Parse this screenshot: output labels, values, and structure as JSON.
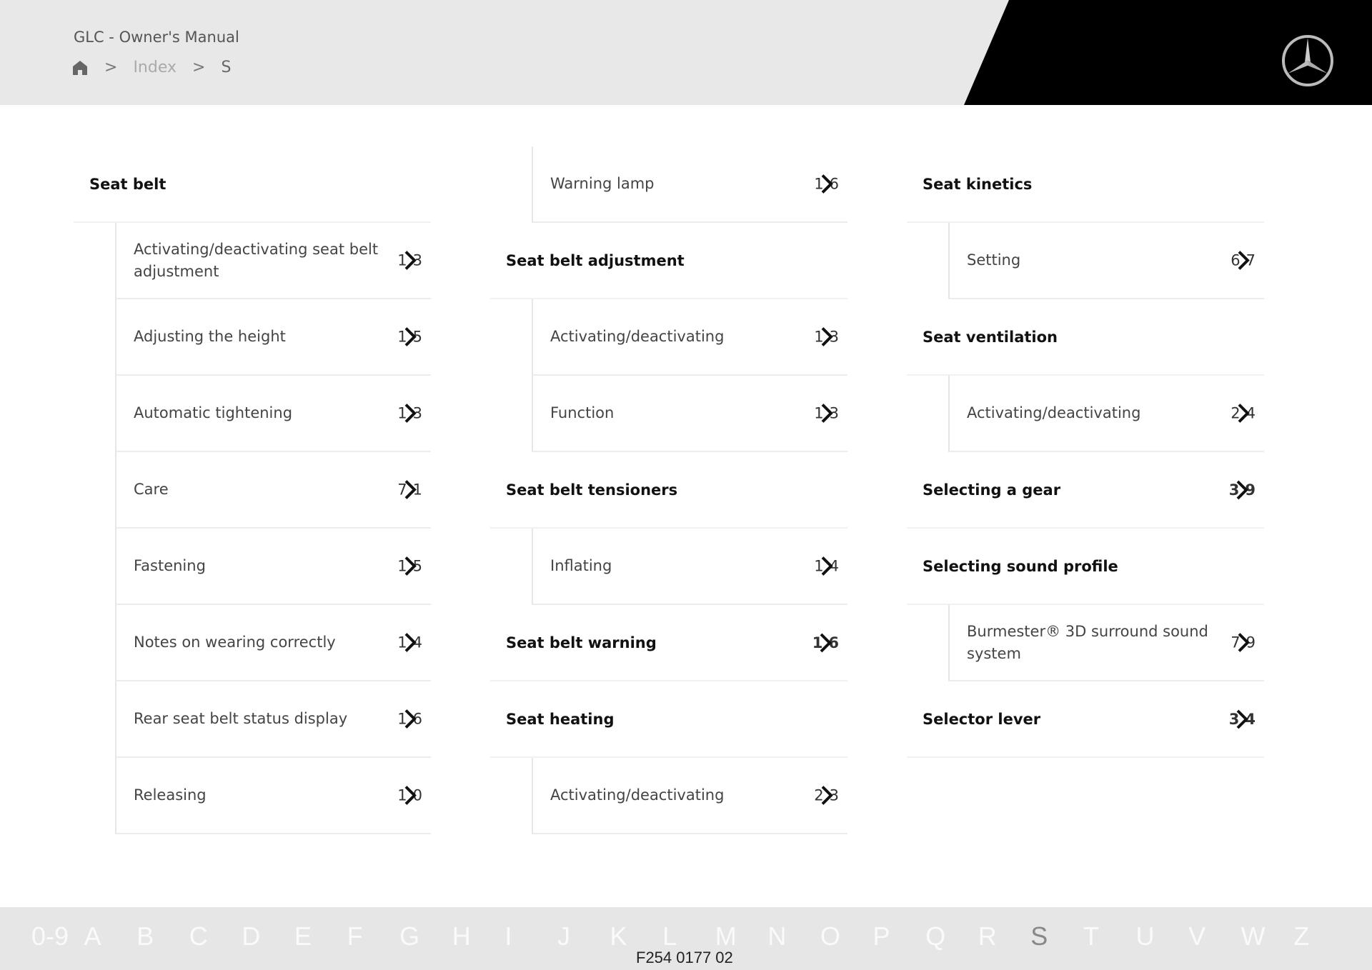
{
  "header": {
    "title": "GLC - Owner's Manual",
    "breadcrumb": [
      {
        "label": "home-icon"
      },
      {
        "label": "Index"
      },
      {
        "label": "S"
      }
    ],
    "logo": "mercedes-star-icon"
  },
  "columns": [
    [
      {
        "type": "head",
        "label": "Seat belt",
        "page": null,
        "sep": true
      },
      {
        "type": "sub",
        "label": "Activating/deactivating seat belt adjustment",
        "page": [
          "1",
          "3"
        ]
      },
      {
        "type": "sub",
        "label": "Adjusting the height",
        "page": [
          "1",
          "5"
        ]
      },
      {
        "type": "sub",
        "label": "Automatic tightening",
        "page": [
          "1",
          "3"
        ]
      },
      {
        "type": "sub",
        "label": "Care",
        "page": [
          "7",
          "1"
        ]
      },
      {
        "type": "sub",
        "label": "Fastening",
        "page": [
          "1",
          "5"
        ]
      },
      {
        "type": "sub",
        "label": "Notes on wearing correctly",
        "page": [
          "1",
          "4"
        ]
      },
      {
        "type": "sub",
        "label": "Rear seat belt status display",
        "page": [
          "1",
          "6"
        ]
      },
      {
        "type": "sub",
        "label": "Releasing",
        "page": [
          "1",
          "0"
        ]
      }
    ],
    [
      {
        "type": "sub",
        "label": "Warning lamp",
        "page": [
          "1",
          "6"
        ]
      },
      {
        "type": "head",
        "label": "Seat belt adjustment",
        "page": null,
        "sep": true
      },
      {
        "type": "sub",
        "label": "Activating/deactivating",
        "page": [
          "1",
          "3"
        ]
      },
      {
        "type": "sub",
        "label": "Function",
        "page": [
          "1",
          "3"
        ]
      },
      {
        "type": "head",
        "label": "Seat belt tensioners",
        "page": null,
        "sep": true
      },
      {
        "type": "sub",
        "label": "Inflating",
        "page": [
          "1",
          "4"
        ]
      },
      {
        "type": "head",
        "label": "Seat belt warning",
        "page": [
          "1",
          "6"
        ],
        "sep": true
      },
      {
        "type": "head",
        "label": "Seat heating",
        "page": null,
        "sep": true
      },
      {
        "type": "sub",
        "label": "Activating/deactivating",
        "page": [
          "2",
          "3"
        ]
      }
    ],
    [
      {
        "type": "head",
        "label": "Seat kinetics",
        "page": null,
        "sep": true
      },
      {
        "type": "sub",
        "label": "Setting",
        "page": [
          "6",
          "7"
        ]
      },
      {
        "type": "head",
        "label": "Seat ventilation",
        "page": null,
        "sep": true
      },
      {
        "type": "sub",
        "label": "Activating/deactivating",
        "page": [
          "2",
          "4"
        ]
      },
      {
        "type": "head",
        "label": "Selecting a gear",
        "page": [
          "3",
          "9"
        ],
        "sep": true
      },
      {
        "type": "head",
        "label": "Selecting sound profile",
        "page": null,
        "sep": true
      },
      {
        "type": "sub",
        "label": "Burmester® 3D surround sound system",
        "page": [
          "7",
          "9"
        ]
      },
      {
        "type": "head",
        "label": "Selector lever",
        "page": [
          "3",
          "4"
        ],
        "sep": true
      }
    ]
  ],
  "alphabet": {
    "letters": [
      "0-9",
      "A",
      "B",
      "C",
      "D",
      "E",
      "F",
      "G",
      "H",
      "I",
      "J",
      "K",
      "L",
      "M",
      "N",
      "O",
      "P",
      "Q",
      "R",
      "S",
      "T",
      "U",
      "V",
      "W",
      "Z"
    ],
    "active": "S"
  },
  "footer": {
    "code": "F254 0177 02"
  }
}
